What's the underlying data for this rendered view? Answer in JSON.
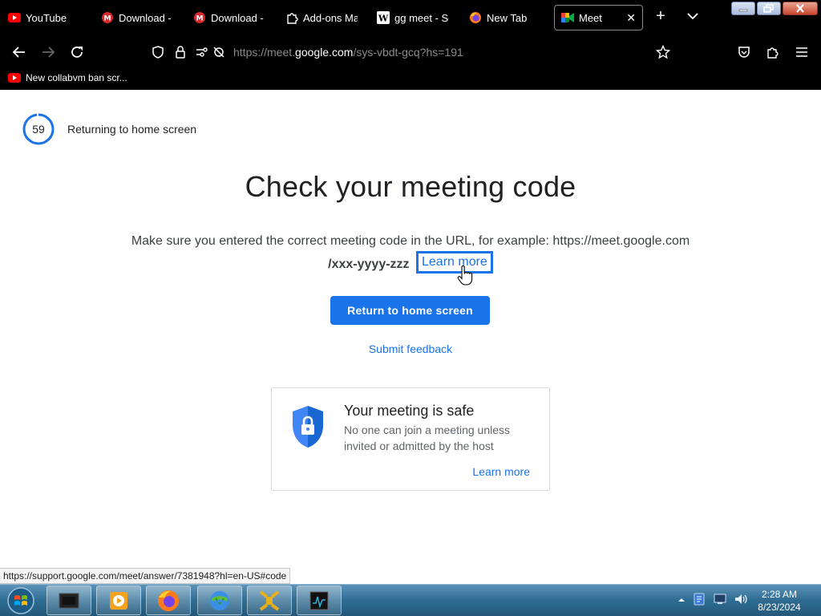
{
  "browser": {
    "tabs": [
      {
        "title": "YouTube",
        "icon": "youtube-icon"
      },
      {
        "title": "Download - M",
        "icon": "mega-icon"
      },
      {
        "title": "Download - M",
        "icon": "mega-icon"
      },
      {
        "title": "Add-ons Man",
        "icon": "puzzle-icon"
      },
      {
        "title": "gg meet - Se",
        "icon": "wikipedia-icon"
      },
      {
        "title": "New Tab",
        "icon": "firefox-icon"
      },
      {
        "title": "Meet",
        "icon": "meet-icon",
        "active": true
      }
    ],
    "new_tab": "+",
    "url_prefix": "https://meet.",
    "url_host": "google.com",
    "url_path": "/sys-vbdt-gcq?hs=191",
    "bookmark": "New collabvm ban scr...",
    "status_url": "https://support.google.com/meet/answer/7381948?hl=en-US#code"
  },
  "page": {
    "countdown": "59",
    "countdown_fraction": 0.98,
    "countdown_label": "Returning to home screen",
    "headline": "Check your meeting code",
    "desc_line1": "Make sure you entered the correct meeting code in the URL, for example: https://meet.google.com",
    "desc_code": "/xxx-yyyy-zzz",
    "learn_more": "Learn more",
    "primary_button": "Return to home screen",
    "feedback": "Submit feedback",
    "safe_card": {
      "title": "Your meeting is safe",
      "body": "No one can join a meeting unless invited or admitted by the host",
      "link": "Learn more"
    }
  },
  "taskbar": {
    "time": "2:28 AM",
    "date": "8/23/2024"
  },
  "colors": {
    "accent": "#1a73e8",
    "text": "#202124"
  }
}
